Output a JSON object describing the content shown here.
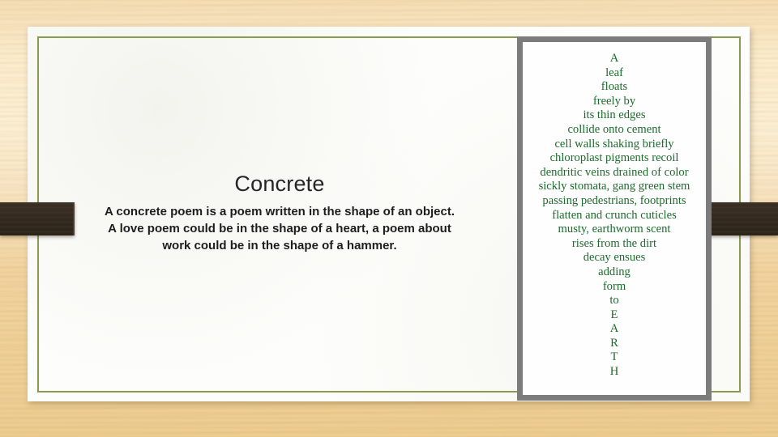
{
  "background": {
    "surface": "wood-desk",
    "wood_light": "#fbeccd",
    "wood_dark": "#eccb8e",
    "band_color": "#342a1f"
  },
  "page": {
    "paper_color": "#fdfdfb",
    "border_color": "#8a9b50"
  },
  "slide": {
    "title": "Concrete",
    "body_lines": [
      "A concrete poem is a poem written in the shape of an object.",
      "A love poem could be in the shape of a heart, a poem about",
      "work could be in the shape of a hammer."
    ]
  },
  "poem_image": {
    "frame_color": "#7c7c7c",
    "text_color": "#1d6b2c",
    "shape": "leaf-tapering-triangle",
    "lines": [
      "A",
      "leaf",
      "floats",
      "freely by",
      "its thin edges",
      "collide onto cement",
      "cell walls shaking briefly",
      "chloroplast pigments recoil",
      "dendritic veins drained of color",
      "sickly stomata, gang green stem",
      "passing pedestrians, footprints",
      "flatten and crunch cuticles",
      "musty, earthworm scent",
      "rises from the dirt",
      "decay ensues",
      "adding",
      "form",
      "to",
      "E",
      "A",
      "R",
      "T",
      "H"
    ]
  }
}
